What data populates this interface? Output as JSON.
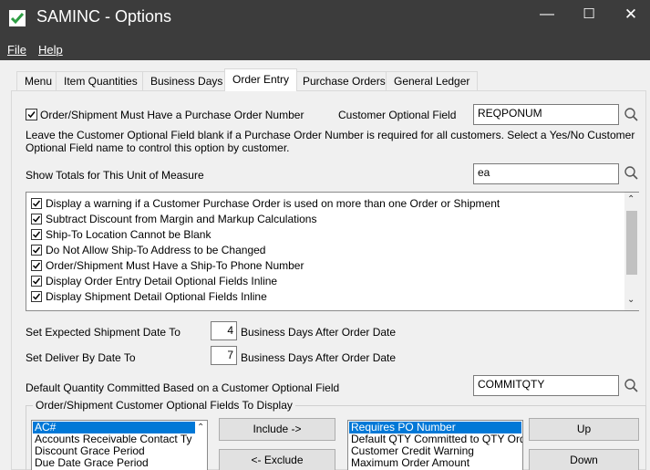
{
  "window": {
    "title": "SAMINC - Options",
    "minimize": "—",
    "maximize": "☐",
    "close": "✕"
  },
  "menu": {
    "file": "File",
    "help": "Help"
  },
  "tabs": [
    "Menu",
    "Item Quantities",
    "Business Days",
    "Order Entry",
    "Purchase Orders",
    "General Ledger"
  ],
  "order_entry": {
    "po_required_label": "Order/Shipment Must Have a Purchase Order Number",
    "po_required_checked": true,
    "customer_optional_field_label": "Customer Optional Field",
    "customer_optional_field_value": "REQPONUM",
    "help_text": "Leave the Customer Optional Field blank if a Purchase Order Number is required for all customers. Select a Yes/No Customer Optional Field name to control this option by customer.",
    "show_totals_label": "Show Totals for This Unit of Measure",
    "show_totals_value": "ea",
    "options": [
      {
        "label": "Display a warning if a Customer Purchase Order is used on more than one Order or Shipment",
        "checked": true
      },
      {
        "label": "Subtract Discount from Margin and Markup Calculations",
        "checked": true
      },
      {
        "label": "Ship-To Location Cannot be Blank",
        "checked": true
      },
      {
        "label": "Do Not Allow Ship-To Address to be Changed",
        "checked": true
      },
      {
        "label": "Order/Shipment Must Have a Ship-To Phone Number",
        "checked": true
      },
      {
        "label": "Display Order Entry Detail Optional Fields Inline",
        "checked": true
      },
      {
        "label": "Display Shipment Detail Optional Fields Inline",
        "checked": true
      }
    ],
    "expected_ship_label": "Set Expected Shipment Date To",
    "expected_ship_days": "4",
    "expected_ship_suffix": "Business Days After Order Date",
    "deliver_by_label": "Set Deliver By Date To",
    "deliver_by_days": "7",
    "deliver_by_suffix": "Business Days After Order Date",
    "default_qty_label": "Default Quantity Committed Based on a Customer Optional Field",
    "default_qty_value": "COMMITQTY",
    "group_label": "Order/Shipment Customer Optional Fields To Display",
    "available_fields": [
      "AC#",
      "Accounts Receivable Contact Ty",
      "Discount Grace Period",
      "Due Date Grace Period"
    ],
    "selected_fields": [
      "Requires PO Number",
      "Default QTY Committed to QTY Orde",
      "Customer Credit Warning",
      "Maximum Order Amount"
    ],
    "include_button": "Include ->",
    "exclude_button": "<- Exclude",
    "up_button": "Up",
    "down_button": "Down"
  },
  "colors": {
    "titlebar": "#3c3c3c",
    "selection": "#0078d7",
    "icon_green": "#2e9e44"
  }
}
